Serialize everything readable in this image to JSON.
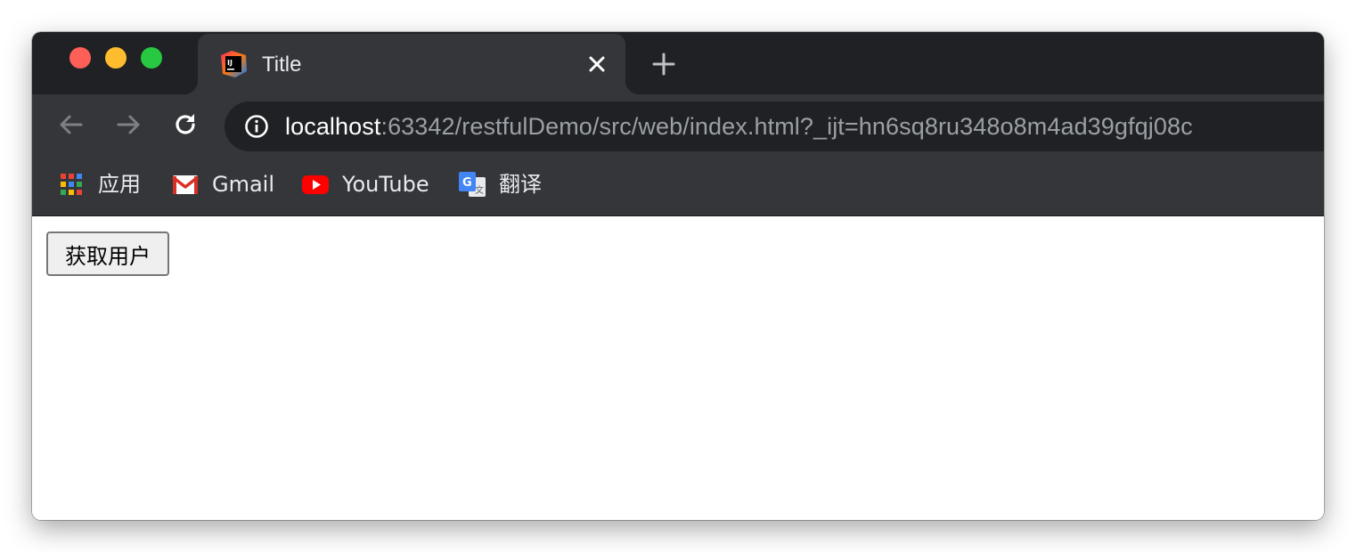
{
  "tab": {
    "title": "Title",
    "favicon": "intellij-idea-icon"
  },
  "toolbar": {
    "url_host": "localhost",
    "url_rest": ":63342/restfulDemo/src/web/index.html?_ijt=hn6sq8ru348o8m4ad39gfqj08c"
  },
  "bookmarks": [
    {
      "label": "应用",
      "icon": "apps-grid-icon"
    },
    {
      "label": "Gmail",
      "icon": "gmail-icon"
    },
    {
      "label": "YouTube",
      "icon": "youtube-icon"
    },
    {
      "label": "翻译",
      "icon": "google-translate-icon"
    }
  ],
  "page": {
    "get_user_button": "获取用户"
  },
  "colors": {
    "tabstrip": "#202124",
    "toolbar": "#35363a",
    "close": "#fe5f57",
    "minimize": "#febc2e",
    "maximize": "#28c840"
  }
}
